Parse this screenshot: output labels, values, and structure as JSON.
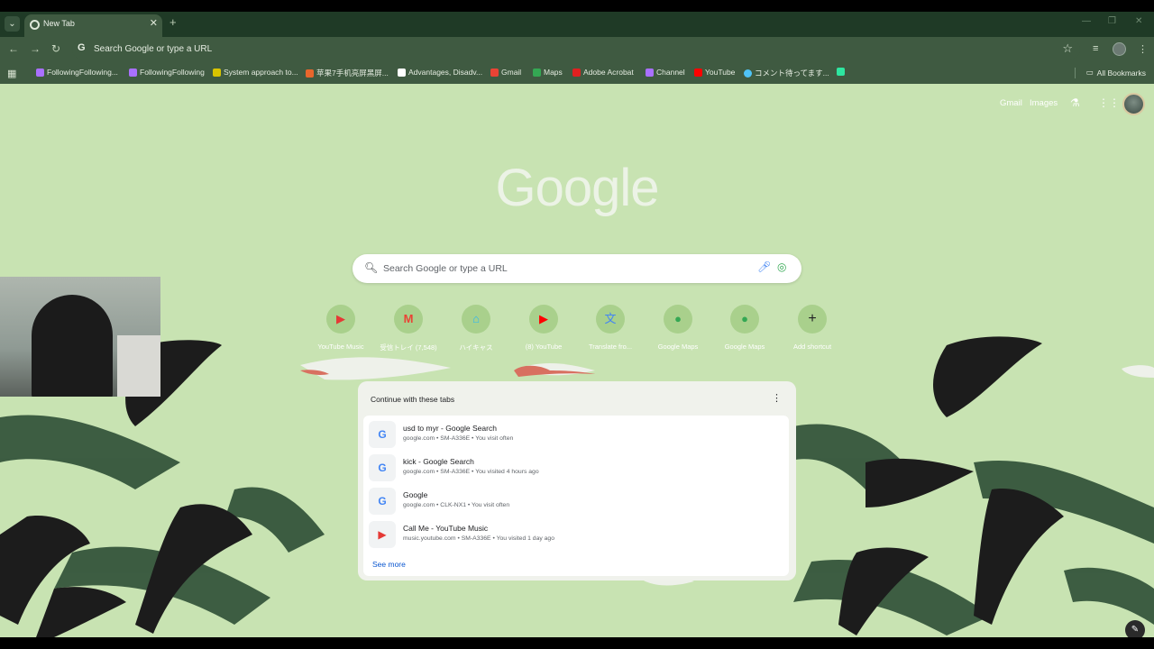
{
  "tab": {
    "title": "New Tab",
    "close": "✕",
    "new_tab": "+"
  },
  "window": {
    "minimize": "—",
    "maximize": "❐",
    "close": "✕"
  },
  "toolbar": {
    "back": "←",
    "forward": "→",
    "reload": "↻",
    "omnibox_text": "Search Google or type a URL"
  },
  "bookmarks": {
    "items": [
      {
        "label": "FollowingFollowing...",
        "color": "#a970ff"
      },
      {
        "label": "FollowingFollowing",
        "color": "#a970ff"
      },
      {
        "label": "System approach to...",
        "color": "#d9c400"
      },
      {
        "label": "苹果7手机亮屏黑屏...",
        "color": "#e8662c"
      },
      {
        "label": "Advantages, Disadv...",
        "color": "#ffffff"
      },
      {
        "label": "Gmail",
        "color": "#ea4335"
      },
      {
        "label": "Maps",
        "color": "#34a853"
      },
      {
        "label": "Adobe Acrobat",
        "color": "#e02020"
      },
      {
        "label": "Channel",
        "color": "#a970ff"
      },
      {
        "label": "YouTube",
        "color": "#ff0000"
      },
      {
        "label": "コメント待ってます...",
        "color": "#4fc3f7"
      },
      {
        "label": "",
        "color": "#2ee6a0"
      }
    ],
    "all_bookmarks": "All Bookmarks"
  },
  "ntp": {
    "gmail_link": "Gmail",
    "images_link": "Images",
    "logo": "Google",
    "search_placeholder": "Search Google or type a URL",
    "shortcuts": [
      {
        "label": "YouTube Music",
        "glyph": "▶",
        "color": "#e53935"
      },
      {
        "label": "受信トレイ (7,548)",
        "glyph": "M",
        "color": "#ea4335"
      },
      {
        "label": "ハイキャス",
        "glyph": "⌂",
        "color": "#29b6f6"
      },
      {
        "label": "(8) YouTube",
        "glyph": "▶",
        "color": "#ff0000"
      },
      {
        "label": "Translate fro...",
        "glyph": "文",
        "color": "#4285f4"
      },
      {
        "label": "Google Maps",
        "glyph": "●",
        "color": "#34a853"
      },
      {
        "label": "Google Maps",
        "glyph": "●",
        "color": "#34a853"
      },
      {
        "label": "Add shortcut",
        "glyph": "+",
        "color": "#202124"
      }
    ],
    "continue_card": {
      "title": "Continue with these tabs",
      "menu": "⋮",
      "rows": [
        {
          "title": "usd to myr - Google Search",
          "sub": "google.com • SM-A336E • You visit often",
          "icon": "G"
        },
        {
          "title": "kick - Google Search",
          "sub": "google.com • SM-A336E • You visited 4 hours ago",
          "icon": "G"
        },
        {
          "title": "Google",
          "sub": "google.com • CLK-NX1 • You visit often",
          "icon": "G"
        },
        {
          "title": "Call Me - YouTube Music",
          "sub": "music.youtube.com • SM-A336E • You visited 1 day ago",
          "icon": "▶"
        }
      ],
      "see_more": "See more"
    }
  }
}
